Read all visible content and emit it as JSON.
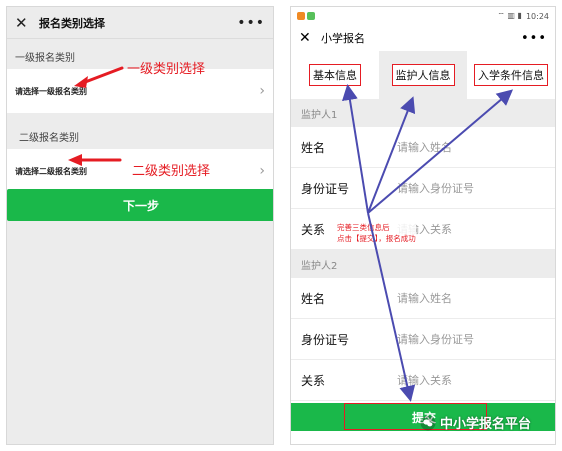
{
  "left": {
    "title": "报名类别选择",
    "close_glyph": "✕",
    "more_glyph": "•••",
    "level1_label": "一级报名类别",
    "level1_placeholder": "请选择一级报名类别",
    "level2_label": "二级报名类别",
    "level2_placeholder": "请选择二级报名类别",
    "chevron_glyph": "›",
    "next_button": "下一步",
    "annotation1": "一级类别选择",
    "annotation2": "二级类别选择"
  },
  "right": {
    "status_time": "10:24",
    "status_glyphs": "⌔ ▥ ▮",
    "close_glyph": "✕",
    "title": "小学报名",
    "more_glyph": "•••",
    "tabs": [
      {
        "label": "基本信息"
      },
      {
        "label": "监护人信息"
      },
      {
        "label": "入学条件信息"
      }
    ],
    "guardian1": {
      "heading": "监护人1",
      "fields": [
        {
          "label": "姓名",
          "placeholder": "请输入姓名"
        },
        {
          "label": "身份证号",
          "placeholder": "请输入身份证号"
        },
        {
          "label": "关系",
          "placeholder": "请输入关系"
        }
      ]
    },
    "guardian2": {
      "heading": "监护人2",
      "fields": [
        {
          "label": "姓名",
          "placeholder": "请输入姓名"
        },
        {
          "label": "身份证号",
          "placeholder": "请输入身份证号"
        },
        {
          "label": "关系",
          "placeholder": "请输入关系"
        }
      ]
    },
    "note_line1": "完善三类信息后",
    "note_line2": "点击【提交】，报名成功",
    "submit_button": "提交"
  },
  "watermark": "中小学报名平台",
  "colors": {
    "green": "#1ab84a",
    "annotation_red": "#e51c23",
    "arrow_blue": "#4b4bb0",
    "background_gray": "#ececec"
  }
}
